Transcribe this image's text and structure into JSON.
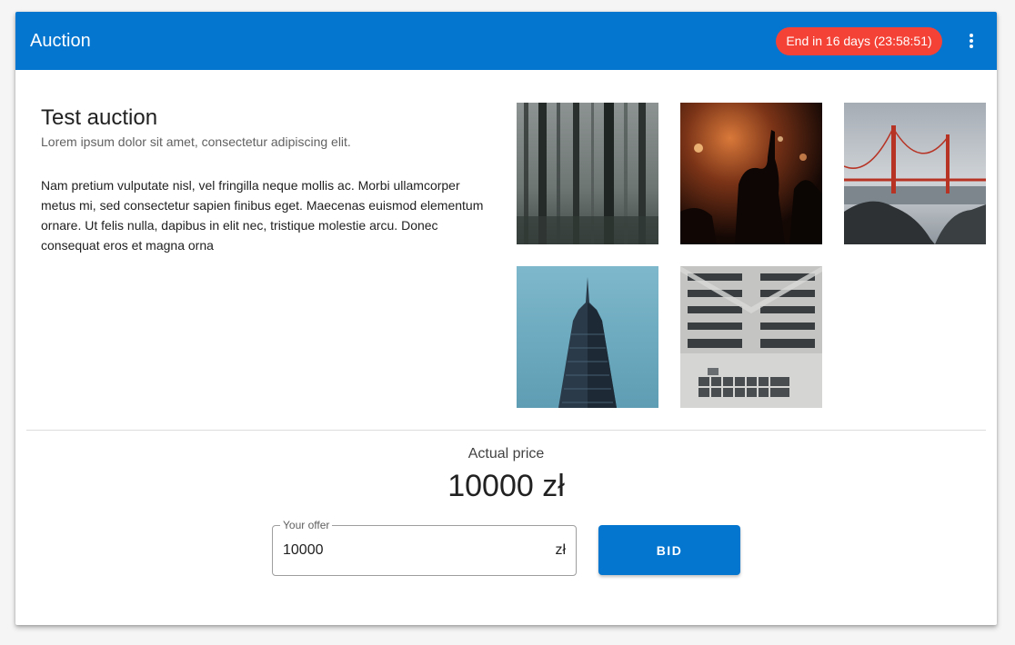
{
  "appbar": {
    "title": "Auction",
    "end_badge": "End in 16 days (23:58:51)",
    "menu_icon": "more-vert-icon"
  },
  "auction": {
    "title": "Test auction",
    "subtitle": "Lorem ipsum dolor sit amet, consectetur adipiscing elit.",
    "description": "Nam pretium vulputate nisl, vel fringilla neque mollis ac. Morbi ullamcorper metus mi, sed consectetur sapien finibus eget. Maecenas euismod elementum ornare. Ut felis nulla, dapibus in elit nec, tristique molestie arcu. Donec consequat eros et magna orna"
  },
  "gallery": {
    "images": [
      {
        "subject": "misty forest"
      },
      {
        "subject": "concert crowd"
      },
      {
        "subject": "golden gate bridge"
      },
      {
        "subject": "skyscraper tower"
      },
      {
        "subject": "apartment building facade"
      }
    ]
  },
  "pricing": {
    "label": "Actual price",
    "value": "10000 zł"
  },
  "offer": {
    "label": "Your offer",
    "value": "10000",
    "suffix": "zł",
    "button_label": "BID"
  },
  "colors": {
    "primary": "#0476d0",
    "badge": "#f44336"
  }
}
